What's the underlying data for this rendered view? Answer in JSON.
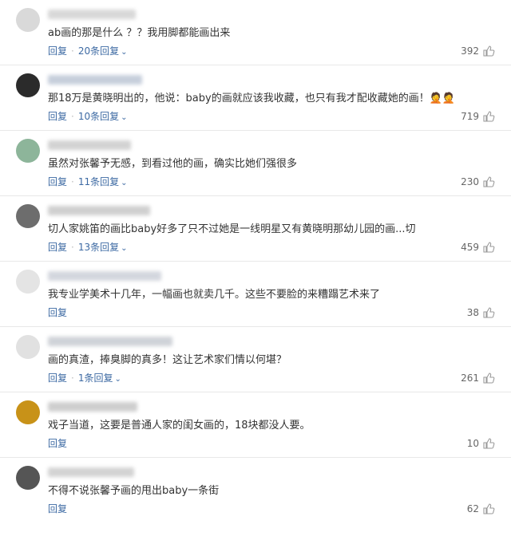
{
  "comments": [
    {
      "text": "ab画的那是什么 ？？我用脚都能画出来",
      "reply_label": "回复",
      "replies_label": "20条回复",
      "likes": "392",
      "avatar_color": "#d9d9d9",
      "username_color": "#cfcfcf"
    },
    {
      "text": "那18万是黄晓明出的，他说：baby的画就应该我收藏，也只有我才配收藏她的画！🤦🤦",
      "reply_label": "回复",
      "replies_label": "10条回复",
      "likes": "719",
      "avatar_color": "#2b2b2b",
      "username_color": "#b9c3d3"
    },
    {
      "text": "虽然对张馨予无感，到看过他的画，确实比她们强很多",
      "reply_label": "回复",
      "replies_label": "11条回复",
      "likes": "230",
      "avatar_color": "#8db59a",
      "username_color": "#c8c8c8"
    },
    {
      "text": "切人家姚笛的画比baby好多了只不过她是一线明星又有黄晓明那幼儿园的画...切",
      "reply_label": "回复",
      "replies_label": "13条回复",
      "likes": "459",
      "avatar_color": "#6d6d6d",
      "username_color": "#c4c4c4"
    },
    {
      "text": "我专业学美术十几年，一幅画也就卖几千。这些不要脸的来糟蹋艺术来了",
      "reply_label": "回复",
      "replies_label": "",
      "likes": "38",
      "avatar_color": "#e4e4e4",
      "username_color": "#c9cdd6"
    },
    {
      "text": "画的真渣，捧臭脚的真多！这让艺术家们情以何堪？",
      "reply_label": "回复",
      "replies_label": "1条回复",
      "likes": "261",
      "avatar_color": "#e1e1e1",
      "username_color": "#c4c8cf"
    },
    {
      "text": "戏子当道，这要是普通人家的闺女画的，18块都没人要。",
      "reply_label": "回复",
      "replies_label": "",
      "likes": "10",
      "avatar_color": "#c89218",
      "username_color": "#c2c2c2"
    },
    {
      "text": "不得不说张馨予画的甩出baby一条街",
      "reply_label": "回复",
      "replies_label": "",
      "likes": "62",
      "avatar_color": "#555555",
      "username_color": "#c9c9c9"
    }
  ],
  "colors": {
    "link": "#3d6aa3",
    "text": "#333333",
    "like_count": "#666666",
    "divider": "#e8e8e8",
    "thumb_icon": "#9a9a9a"
  },
  "icons": {
    "thumb": "thumbs-up-icon",
    "chevron": "chevron-down-icon"
  }
}
